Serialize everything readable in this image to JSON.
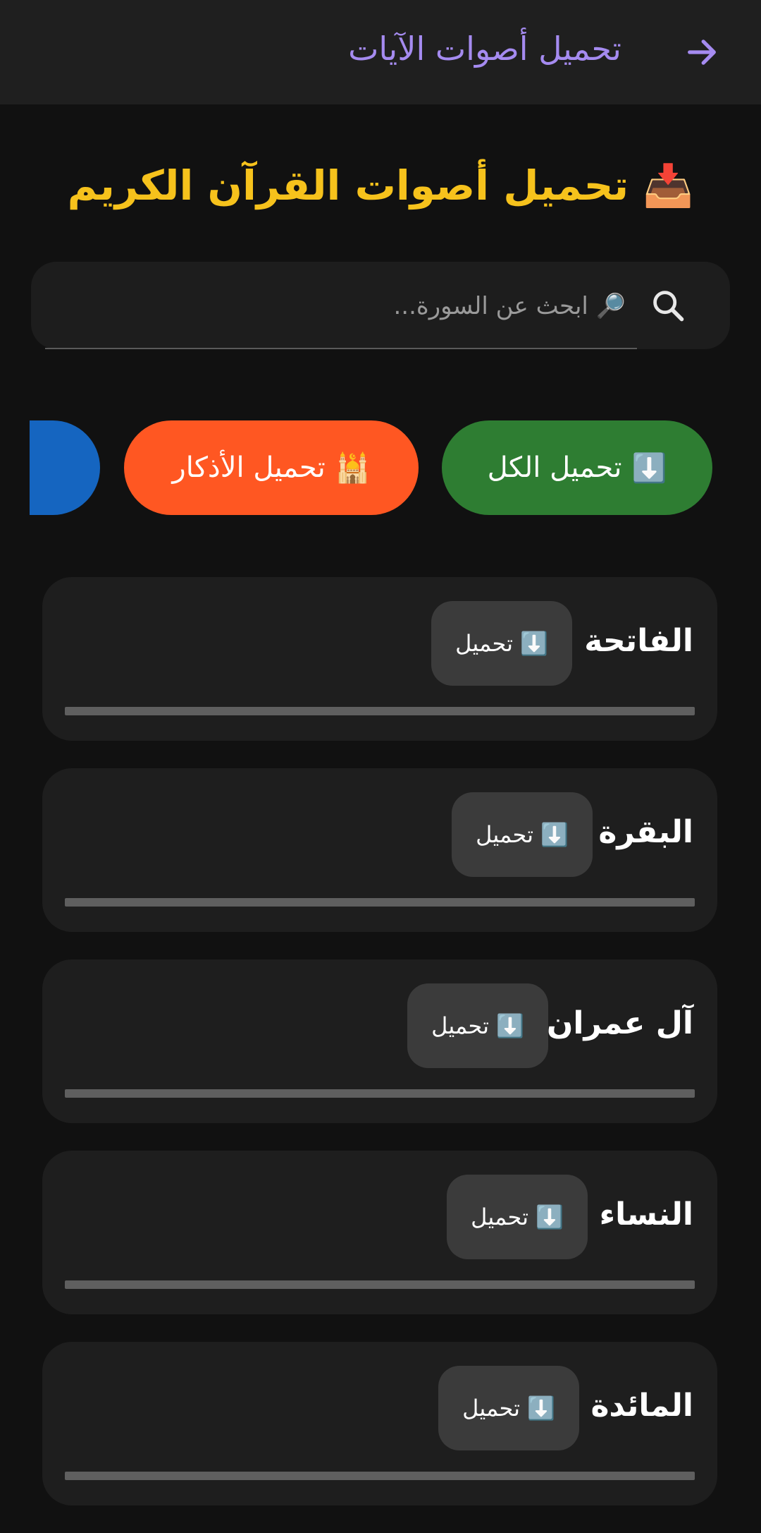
{
  "appbar": {
    "title": "تحميل أصوات الآيات",
    "back_icon": "arrow-right-icon",
    "accent": "#a58bf0"
  },
  "header": {
    "emoji": "📥",
    "title": "تحميل أصوات القرآن الكريم",
    "color": "#f6c21c"
  },
  "search": {
    "placeholder": "🔎 ابحث عن السورة...",
    "value": "",
    "icon": "search-icon"
  },
  "actions": [
    {
      "emoji": "⬇️",
      "label": "تحميل الكل",
      "color": "#2e7d32"
    },
    {
      "emoji": "🕌",
      "label": "تحميل الأذكار",
      "color": "#ff5722"
    },
    {
      "emoji": "💾",
      "label": "",
      "color": "#1565c0"
    }
  ],
  "surahs": [
    {
      "name": "الفاتحة",
      "button_emoji": "⬇️",
      "button_label": "تحميل",
      "progress": 0
    },
    {
      "name": "البقرة",
      "button_emoji": "⬇️",
      "button_label": "تحميل",
      "progress": 0
    },
    {
      "name": "آل عمران",
      "button_emoji": "⬇️",
      "button_label": "تحميل",
      "progress": 0
    },
    {
      "name": "النساء",
      "button_emoji": "⬇️",
      "button_label": "تحميل",
      "progress": 0
    },
    {
      "name": "المائدة",
      "button_emoji": "⬇️",
      "button_label": "تحميل",
      "progress": 0
    }
  ]
}
